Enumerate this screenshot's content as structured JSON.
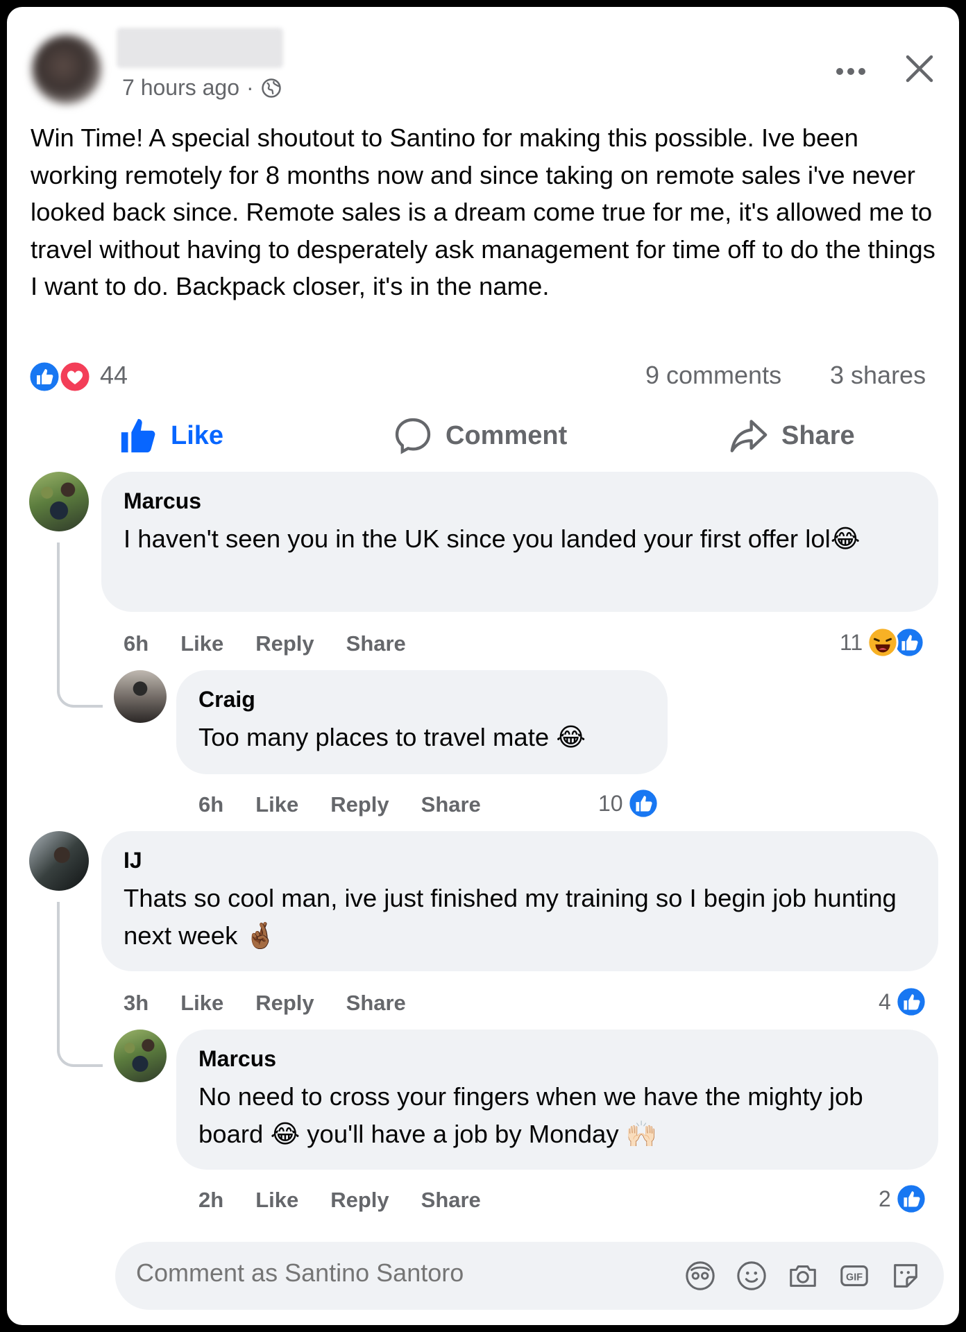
{
  "post": {
    "timestamp": "7 hours ago",
    "separator": "·",
    "text": "Win Time! A special shoutout to Santino for making this possible. Ive been working remotely for 8 months now and since taking on remote sales i've never looked back since. Remote sales is a dream come true for me, it's allowed me to travel without having to desperately ask management for time off to do the things I want to do. Backpack closer, it's in the name.",
    "reaction_count": "44",
    "comments_count": "9 comments",
    "shares_count": "3 shares"
  },
  "actions": {
    "like": "Like",
    "comment": "Comment",
    "share": "Share"
  },
  "comments": [
    {
      "author": "Marcus",
      "text": "I haven't seen you in the UK since you landed your first offer lol😂",
      "time": "6h",
      "like": "Like",
      "reply": "Reply",
      "share": "Share",
      "reactions": "11"
    },
    {
      "author": "Craig",
      "text": "Too many places to travel mate 😂",
      "time": "6h",
      "like": "Like",
      "reply": "Reply",
      "share": "Share",
      "reactions": "10"
    },
    {
      "author": "IJ",
      "text": "Thats so cool man, ive just finished my training so I begin job hunting next week 🤞🏾",
      "time": "3h",
      "like": "Like",
      "reply": "Reply",
      "share": "Share",
      "reactions": "4"
    },
    {
      "author": "Marcus",
      "text": "No need to cross your fingers when we have the mighty job board 😂 you'll have a job by Monday 🙌🏻",
      "time": "2h",
      "like": "Like",
      "reply": "Reply",
      "share": "Share",
      "reactions": "2"
    }
  ],
  "composer": {
    "placeholder": "Comment as Santino Santoro"
  },
  "colors": {
    "accent": "#0866ff",
    "love": "#f33e58",
    "haha": "#f7b125",
    "muted_text": "#65676b",
    "bubble": "#f0f2f5"
  },
  "icons": [
    "globe-icon",
    "more-icon",
    "close-icon",
    "like-reaction-icon",
    "love-reaction-icon",
    "haha-reaction-icon",
    "thumbs-up-icon",
    "comment-icon",
    "share-icon",
    "avatar-icon",
    "emoji-icon",
    "camera-icon",
    "gif-icon",
    "sticker-icon"
  ]
}
